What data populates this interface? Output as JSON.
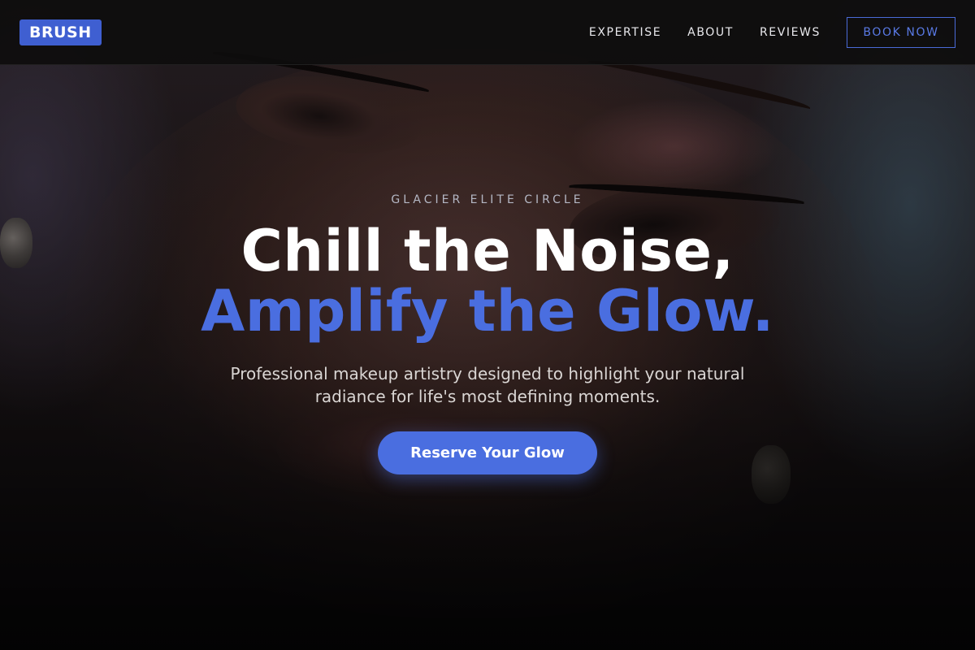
{
  "brand": {
    "logo_text": "BRUSH",
    "accent_color": "#4a6ee0"
  },
  "nav": {
    "links": [
      {
        "label": "EXPERTISE"
      },
      {
        "label": "ABOUT"
      },
      {
        "label": "REVIEWS"
      }
    ],
    "cta_label": "BOOK NOW"
  },
  "hero": {
    "eyebrow": "GLACIER ELITE CIRCLE",
    "headline_line1": "Chill the Noise,",
    "headline_line2": "Amplify the Glow.",
    "subtitle": "Professional makeup artistry designed to highlight your natural radiance for life's most defining moments.",
    "cta_label": "Reserve Your Glow",
    "background_image": "close-up-makeup-portrait"
  }
}
